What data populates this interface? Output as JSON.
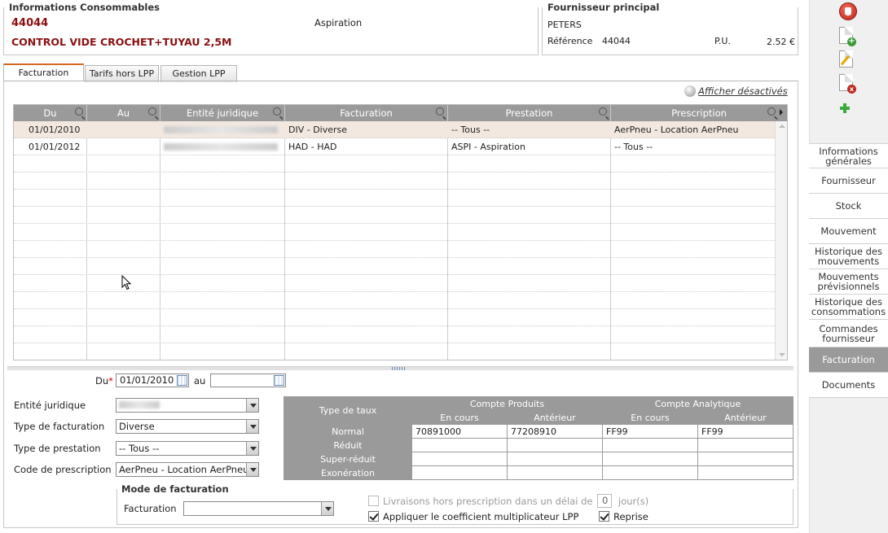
{
  "conso": {
    "title": "Informations Consommables",
    "code": "44044",
    "category": "Aspiration",
    "name": "CONTROL VIDE CROCHET+TUYAU 2,5M"
  },
  "supplier": {
    "title": "Fournisseur principal",
    "name": "PETERS",
    "ref_label": "Référence",
    "ref_value": "44044",
    "pu_label": "P.U.",
    "pu_value": "2.52 €"
  },
  "tabs": [
    "Facturation",
    "Tarifs hors LPP",
    "Gestion LPP"
  ],
  "show_disabled": "Afficher désactivés",
  "grid": {
    "columns": [
      "Du",
      "Au",
      "Entité juridique",
      "Facturation",
      "Prestation",
      "Prescription"
    ],
    "rows": [
      {
        "du": "01/01/2010",
        "au": "",
        "facturation": "DIV - Diverse",
        "prestation": "-- Tous --",
        "prescription": "AerPneu - Location AerPneu"
      },
      {
        "du": "01/01/2012",
        "au": "",
        "facturation": "HAD - HAD",
        "prestation": "ASPI - Aspiration",
        "prescription": "-- Tous --"
      }
    ]
  },
  "form": {
    "du_label": "Du",
    "du_required": "*",
    "du_value": "01/01/2010",
    "au_label": "au",
    "au_value": "",
    "entite_label": "Entité juridique",
    "type_fact_label": "Type de facturation",
    "type_fact_value": "Diverse",
    "type_prest_label": "Type de prestation",
    "type_prest_value": "-- Tous --",
    "code_presc_label": "Code de prescription",
    "code_presc_value": "AerPneu - Location AerPneu"
  },
  "taux": {
    "type_header": "Type de taux",
    "cp_header": "Compte Produits",
    "ca_header": "Compte Analytique",
    "en_cours": "En cours",
    "anterieur": "Antérieur",
    "rows": [
      {
        "label": "Normal",
        "cp_cours": "70891000",
        "cp_ant": "77208910",
        "ca_cours": "FF99",
        "ca_ant": "FF99"
      },
      {
        "label": "Réduit",
        "cp_cours": "",
        "cp_ant": "",
        "ca_cours": "",
        "ca_ant": ""
      },
      {
        "label": "Super-réduit",
        "cp_cours": "",
        "cp_ant": "",
        "ca_cours": "",
        "ca_ant": ""
      },
      {
        "label": "Exonération",
        "cp_cours": "",
        "cp_ant": "",
        "ca_cours": "",
        "ca_ant": ""
      }
    ]
  },
  "mode": {
    "title": "Mode de facturation",
    "fact_label": "Facturation",
    "fact_value": "",
    "livraisons_label": "Livraisons hors prescription dans un délai de",
    "delai_value": "0",
    "jours_label": "jour(s)",
    "coef_label": "Appliquer le coefficient multiplicateur LPP",
    "reprise_label": "Reprise"
  },
  "sidebar": [
    "Informations générales",
    "Fournisseur",
    "Stock",
    "Mouvement",
    "Historique des mouvements",
    "Mouvements prévisionnels",
    "Historique des consommations",
    "Commandes fournisseur",
    "Facturation",
    "Documents"
  ]
}
